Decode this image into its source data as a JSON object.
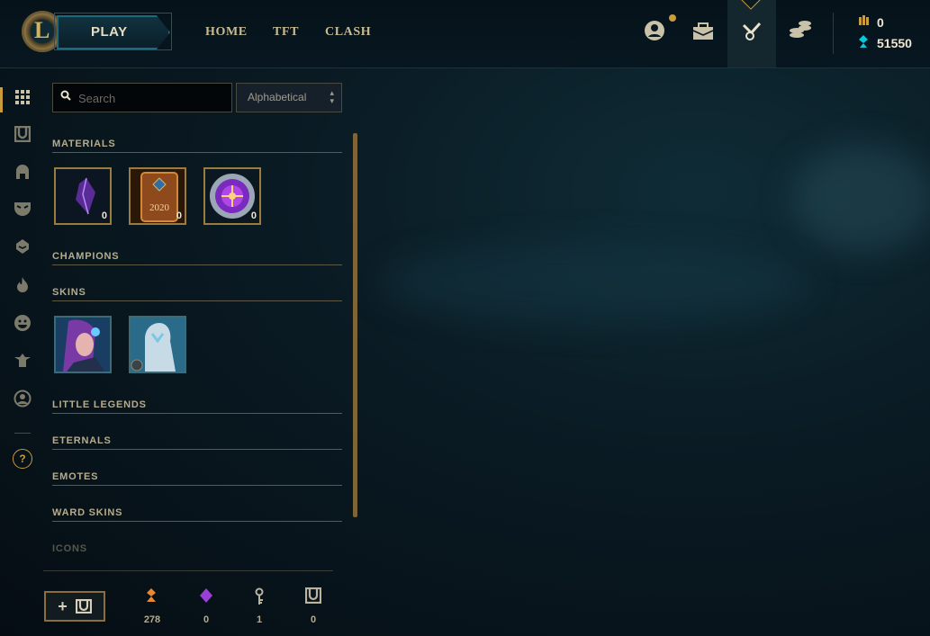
{
  "topbar": {
    "play_label": "PLAY",
    "nav": [
      "HOME",
      "TFT",
      "CLASH"
    ],
    "icons": [
      "profile-icon",
      "store-bag-icon",
      "loot-crafting-icon",
      "coins-icon"
    ],
    "currency": {
      "orange_essence": "0",
      "blue_essence": "51550"
    }
  },
  "sidebar": {
    "icons": [
      "grid-icon",
      "chest-icon",
      "helmet-icon",
      "mask-icon",
      "champion-face-icon",
      "flame-icon",
      "emote-face-icon",
      "totem-icon",
      "profile-circle-icon",
      "help-icon"
    ],
    "help_label": "?"
  },
  "filters": {
    "search_placeholder": "Search",
    "sort_value": "Alphabetical"
  },
  "categories": {
    "materials": "MATERIALS",
    "champions": "CHAMPIONS",
    "skins": "SKINS",
    "little_legends": "LITTLE LEGENDS",
    "eternals": "ETERNALS",
    "emotes": "EMOTES",
    "ward_skins": "WARD SKINS",
    "icons": "ICONS"
  },
  "materials": [
    {
      "icon": "purple-shard-icon",
      "count": "0"
    },
    {
      "icon": "event-pass-2020-icon",
      "count": "0",
      "label": "2020"
    },
    {
      "icon": "purple-orb-icon",
      "count": "0"
    }
  ],
  "bottom": {
    "add_label": "+",
    "resources": [
      {
        "icon": "orange-essence-icon",
        "value": "278",
        "color": "#e8892f"
      },
      {
        "icon": "purple-gem-icon",
        "value": "0",
        "color": "#9a3fd6"
      },
      {
        "icon": "key-icon",
        "value": "1",
        "color": "#b9b3a0"
      },
      {
        "icon": "chest-icon",
        "value": "0",
        "color": "#b9b3a0"
      }
    ]
  },
  "colors": {
    "gold": "#c89b3c",
    "hextech_blue": "#0ac8b9"
  }
}
